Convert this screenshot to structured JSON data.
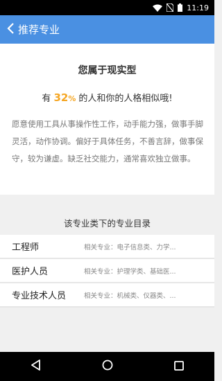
{
  "status_bar": {
    "time": "11:19",
    "icons": [
      "wifi-icon",
      "no-sim-icon",
      "battery-icon"
    ]
  },
  "app_bar": {
    "back_icon": "chevron-left-icon",
    "title": "推荐专业"
  },
  "result": {
    "title": "您属于现实型",
    "stat_prefix": "有",
    "stat_percent_number": "32",
    "stat_percent_symbol": "%",
    "stat_suffix": "的人和你的人格相似哦!",
    "description": "愿意使用工具从事操作性工作，动手能力强，做事手脚灵活，动作协调。偏好于具体任务，不善言辞，做事保守，较为谦虚。缺乏社交能力，通常喜欢独立做事。"
  },
  "directory": {
    "heading": "该专业类下的专业目录",
    "items": [
      {
        "name": "工程师",
        "related": "相关专业：电子信息类、力学..."
      },
      {
        "name": "医护人员",
        "related": "相关专业：护理学类、基础医..."
      },
      {
        "name": "专业技术人员",
        "related": "相关专业：机械类、仪器类、..."
      }
    ]
  },
  "colors": {
    "app_bar": "#4a90e2",
    "accent": "#f5a623"
  },
  "nav_bar": {
    "icons": [
      "back-triangle-icon",
      "home-circle-icon",
      "recents-square-icon"
    ]
  }
}
